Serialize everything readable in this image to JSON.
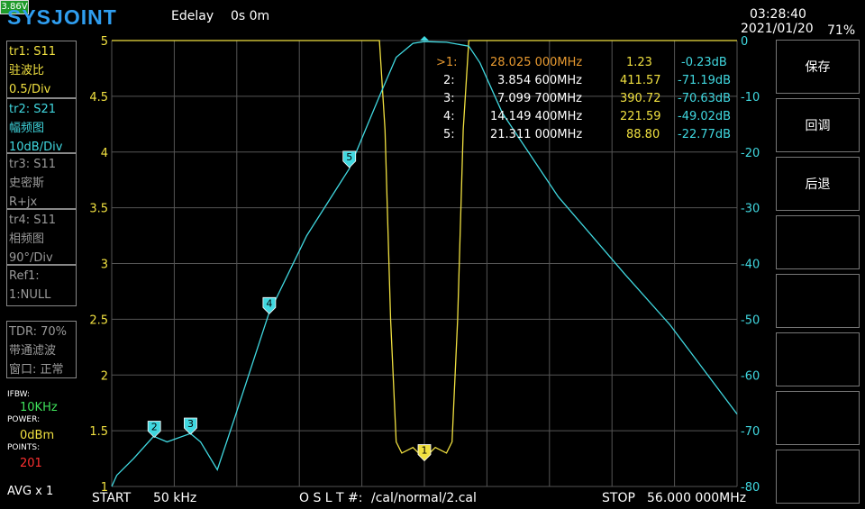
{
  "header": {
    "logo": "SYSJOINT",
    "edelay_label": "Edelay",
    "edelay_value": "0s 0m",
    "time": "03:28:40",
    "date": "2021/01/20",
    "battery_voltage": "3.86V",
    "battery_percent": "71%"
  },
  "traces": [
    {
      "line1": "tr1:  S11",
      "line2": "驻波比",
      "line3": "0.5/Div",
      "color": "#f0e040"
    },
    {
      "line1": "tr2:  S21",
      "line2": "幅频图",
      "line3": "10dB/Div",
      "color": "#40d8e0"
    },
    {
      "line1": "tr3:  S11",
      "line2": "史密斯",
      "line3": "R+jx",
      "color": "#9a9a9a"
    },
    {
      "line1": "tr4:  S11",
      "line2": "相频图",
      "line3": "90°/Div",
      "color": "#9a9a9a"
    },
    {
      "line1": "Ref1:",
      "line2": "1:NULL",
      "color": "#9a9a9a"
    },
    {
      "line1": "TDR: 70%",
      "line2": "带通滤波",
      "line3": "窗口: 正常",
      "color": "#9a9a9a"
    }
  ],
  "settings": {
    "ifbw_label": "IFBW:",
    "ifbw_value": "10KHz",
    "power_label": "POWER:",
    "power_value": "0dBm",
    "points_label": "POINTS:",
    "points_value": "201",
    "avg": "AVG x 1"
  },
  "softkeys": [
    "保存",
    "回调",
    "后退",
    "",
    "",
    "",
    "",
    ""
  ],
  "bottom": {
    "start_label": "START",
    "start_value": "50 kHz",
    "cal_label": "O S L T #:",
    "cal_value": "/cal/normal/2.cal",
    "stop_label": "STOP",
    "stop_value": "56.000 000MHz"
  },
  "markers": [
    {
      "id": ">1:",
      "freq": "28.025 000MHz",
      "vswr": "1.23",
      "db": "-0.23dB",
      "active": true
    },
    {
      "id": "2:",
      "freq": "3.854 600MHz",
      "vswr": "411.57",
      "db": "-71.19dB",
      "active": false
    },
    {
      "id": "3:",
      "freq": "7.099 700MHz",
      "vswr": "390.72",
      "db": "-70.63dB",
      "active": false
    },
    {
      "id": "4:",
      "freq": "14.149 400MHz",
      "vswr": "221.59",
      "db": "-49.02dB",
      "active": false
    },
    {
      "id": "5:",
      "freq": "21.311 000MHz",
      "vswr": "88.80",
      "db": "-22.77dB",
      "active": false
    }
  ],
  "colors": {
    "vswr": "#f0e040",
    "s21": "#40d8e0",
    "active_marker": "#e89a30",
    "grid": "#555555"
  },
  "chart_data": {
    "type": "line",
    "x_range_mhz": [
      0.05,
      56.0
    ],
    "left_axis": {
      "ylim": [
        1,
        5
      ],
      "ticks": [
        "5",
        "4.5",
        "4",
        "3.5",
        "3",
        "2.5",
        "2",
        "1.5",
        "1"
      ]
    },
    "right_axis": {
      "ylim": [
        -80,
        0
      ],
      "ticks": [
        "0",
        "-10",
        "-20",
        "-30",
        "-40",
        "-50",
        "-60",
        "-70",
        "-80"
      ]
    },
    "series": [
      {
        "axis": "left",
        "x": [
          0.05,
          20.0,
          24.0,
          24.5,
          25.0,
          25.5,
          26.0,
          27.0,
          28.0,
          29.0,
          30.0,
          30.5,
          31.0,
          31.5,
          32.0,
          32.5,
          33.0,
          56.0
        ],
        "y": [
          5.0,
          5.0,
          5.0,
          4.2,
          2.5,
          1.4,
          1.3,
          1.35,
          1.25,
          1.35,
          1.3,
          1.4,
          2.5,
          4.2,
          5.0,
          5.0,
          5.0,
          5.0
        ]
      },
      {
        "axis": "right",
        "x": [
          0.05,
          0.5,
          2.0,
          3.8,
          5.0,
          7.1,
          8.0,
          9.5,
          11.0,
          14.1,
          17.5,
          21.3,
          24.0,
          25.5,
          27.0,
          28.0,
          30.0,
          32.0,
          33.0,
          35.0,
          40.0,
          46.0,
          50.0,
          56.0
        ],
        "y": [
          -80,
          -78,
          -75,
          -71,
          -72,
          -70.5,
          -72,
          -77,
          -68,
          -49,
          -35,
          -23,
          -10,
          -3,
          -0.5,
          -0.2,
          -0.3,
          -1,
          -4,
          -13,
          -28,
          -42,
          -51,
          -67
        ]
      }
    ],
    "marker_labels": [
      "1",
      "2",
      "3",
      "4",
      "5"
    ]
  }
}
